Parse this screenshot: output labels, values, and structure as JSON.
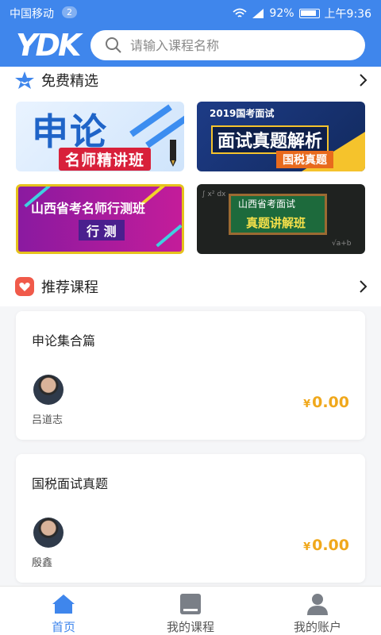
{
  "status_bar": {
    "carrier": "中国移动",
    "badge": "2",
    "battery": "92%",
    "time": "上午9:36"
  },
  "header": {
    "logo": "YDK",
    "search_placeholder": "请输入课程名称"
  },
  "free_section": {
    "title": "免费精选",
    "banners": [
      {
        "line1": "申论",
        "line2": "名师精讲班"
      },
      {
        "line0": "2019国考面试",
        "line1": "面试真题解析",
        "line2": "国税真题"
      },
      {
        "line1": "山西省考名师行测班",
        "line2": "行 测"
      },
      {
        "line1": "山西省考面试",
        "line2": "真题讲解班"
      }
    ]
  },
  "recommend_section": {
    "title": "推荐课程",
    "courses": [
      {
        "title": "申论集合篇",
        "teacher": "吕道志",
        "currency": "¥",
        "price": "0.00"
      },
      {
        "title": "国税面试真题",
        "teacher": "殷鑫",
        "currency": "¥",
        "price": "0.00"
      }
    ]
  },
  "bottom_nav": {
    "items": [
      {
        "label": "首页",
        "icon": "home-icon",
        "active": true
      },
      {
        "label": "我的课程",
        "icon": "book-icon",
        "active": false
      },
      {
        "label": "我的账户",
        "icon": "user-icon",
        "active": false
      }
    ]
  },
  "colors": {
    "primary": "#3f86ec",
    "price": "#f0a81c",
    "star": "#3f86ec",
    "heart": "#f05a4a"
  }
}
